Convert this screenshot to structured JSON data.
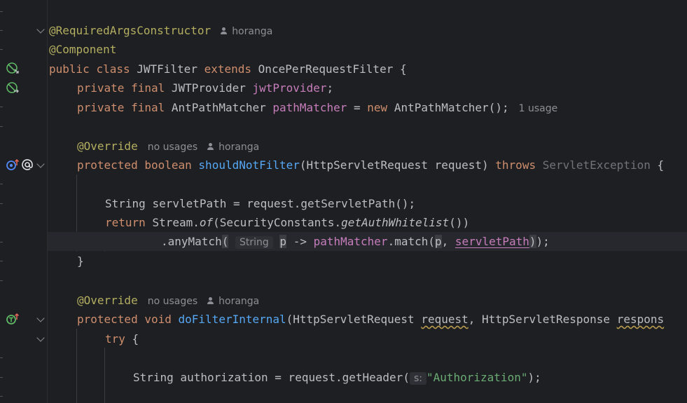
{
  "editor": {
    "lines": [
      {
        "ann1": "@RequiredArgsConstructor",
        "author": "horanga"
      },
      {
        "ann1": "@Component"
      },
      {
        "kw1": "public",
        "kw2": "class",
        "name": "JWTFilter",
        "kw3": "extends",
        "parent": "OncePerRequestFilter",
        "brace": "{"
      },
      {
        "kw1": "private",
        "kw2": "final",
        "type": "JWTProvider",
        "field": "jwtProvider",
        "semi": ";"
      },
      {
        "kw1": "private",
        "kw2": "final",
        "type": "AntPathMatcher",
        "field": "pathMatcher",
        "op": "=",
        "kw3": "new",
        "ctor": "AntPathMatcher();",
        "usage": "1 usage"
      },
      {
        "ann1": "@Override",
        "usage": "no usages",
        "author": "horanga"
      },
      {
        "kw1": "protected",
        "kw2": "boolean",
        "method": "shouldNotFilter",
        "params": "(HttpServletRequest request)",
        "kw3": "throws",
        "exc": "ServletException",
        "brace": "{"
      },
      {
        "type": "String",
        "rest": "servletPath = request.getServletPath();"
      },
      {
        "kw1": "return",
        "pre": "Stream.",
        "m1": "of",
        "mid": "(SecurityConstants.",
        "m2": "getAuthWhitelist",
        "post": "())"
      },
      {
        "pre": ".anyMatch",
        "paren": "(",
        "hint": "String",
        "p1": "p",
        "arrow": "->",
        "field": "pathMatcher",
        "call": ".match(",
        "p2": "p",
        "comma": ",",
        "arg": "servletPath",
        "close": ")",
        "end": ");"
      },
      {
        "brace": "}"
      },
      {
        "ann1": "@Override",
        "usage": "no usages",
        "author": "horanga"
      },
      {
        "kw1": "protected",
        "kw2": "void",
        "method": "doFilterInternal",
        "p1": "(HttpServletRequest",
        "arg1": "request",
        "p2": ", HttpServletResponse",
        "arg2": "respons"
      },
      {
        "kw1": "try",
        "brace": "{"
      },
      {
        "pre": "String authorization = request.getHeader(",
        "hint": "s:",
        "str": "\"Authorization\"",
        "end": ");"
      }
    ]
  },
  "gutter_icons": [
    "implemented-icon",
    "injection-icon",
    "override-icon",
    "annotation-icon",
    "overrides-method-icon"
  ],
  "colors": {
    "background": "#1e1f22",
    "keyword": "#cf8e6d",
    "annotation": "#b3ae60",
    "field": "#c77dbb",
    "method": "#56a8f5",
    "string": "#6aab73"
  }
}
